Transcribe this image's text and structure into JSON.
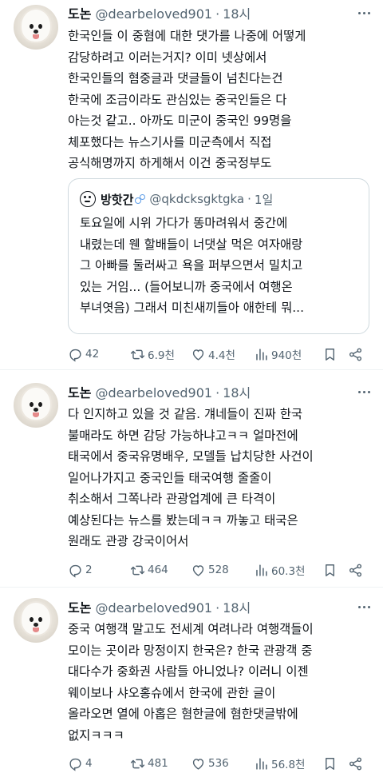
{
  "tweets": [
    {
      "name": "도논",
      "handle": "@dearbeloved901",
      "separator": "·",
      "time": "18시",
      "lines": [
        "한국인들 이 중혐에 대한 댓가를 나중에 어떻게",
        "감당하려고 이러는거지? 이미 넷상에서",
        "한국인들의 혐중글과 댓글들이 넘친다는건",
        "한국에 조금이라도 관심있는 중국인들은 다",
        "아는것 같고.. 아까도 미군이 중국인 99명을",
        "체포했다는 뉴스기사를 미군측에서 직접",
        "공식해명까지 하게해서 이건 중국정부도"
      ],
      "quote": {
        "name": "방핫간",
        "handle": "@qkdcksgktgka",
        "separator": "·",
        "time": "1일",
        "lines": [
          "토요일에 시위 가다가 똥마려워서 중간에",
          "내렸는데 웬 할배들이 너댓살 먹은 여자애랑",
          "그 아빠를 둘러싸고 욕을 퍼부으면서 밀치고",
          "있는 거임... (들어보니까 중국에서 여행온",
          "부녀엿음) 그래서 미친새끼들아 애한테 뭐..."
        ]
      },
      "stats": {
        "replies": "42",
        "retweets": "6.9천",
        "likes": "4.4천",
        "views": "940천"
      }
    },
    {
      "name": "도논",
      "handle": "@dearbeloved901",
      "separator": "·",
      "time": "18시",
      "lines": [
        "다 인지하고 있을 것 같음. 걔네들이 진짜 한국",
        "불매라도 하면 감당 가능하냐고ㅋㅋ 얼마전에",
        "태국에서 중국유명배우, 모델들 납치당한 사건이",
        "일어나가지고 중국인들 태국여행 줄줄이",
        "취소해서 그쪽나라 관광업계에 큰 타격이",
        "예상된다는 뉴스를 봤는데ㅋㅋ 까놓고 태국은",
        "원래도 관광 강국이어서"
      ],
      "stats": {
        "replies": "2",
        "retweets": "464",
        "likes": "528",
        "views": "60.3천"
      }
    },
    {
      "name": "도논",
      "handle": "@dearbeloved901",
      "separator": "·",
      "time": "18시",
      "lines": [
        "중국 여행객 말고도 전세계 여려나라 여행객들이",
        "모이는 곳이라 망정이지 한국은? 한국 관광객 중",
        "대다수가 중화권 사람들 아니었나? 이러니 이젠",
        "웨이보나 샤오홍슈에서 한국에 관한 글이",
        "올라오면 열에 아홉은 혐한글에 혐한댓글밖에",
        "없지ㅋㅋㅋ"
      ],
      "stats": {
        "replies": "4",
        "retweets": "481",
        "likes": "536",
        "views": "56.8천"
      }
    }
  ],
  "colors": {
    "text": "#0f1419",
    "muted": "#536471",
    "border": "#cfd9de",
    "verified_bubble": "#5b9be6"
  },
  "icons": [
    "reply-icon",
    "retweet-icon",
    "like-icon",
    "views-icon",
    "bookmark-icon",
    "share-icon",
    "more-icon"
  ]
}
